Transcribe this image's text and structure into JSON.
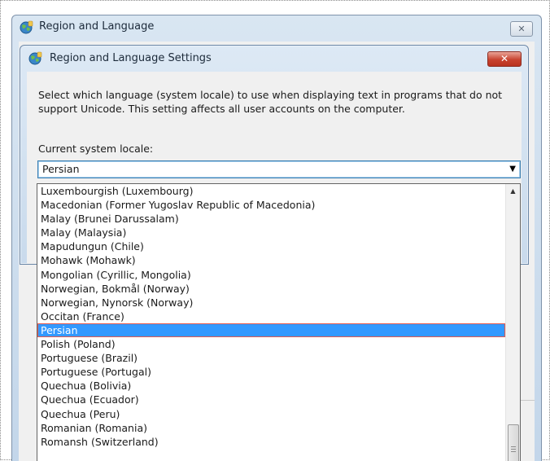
{
  "outer_window": {
    "title": "Region and Language",
    "close_glyph": "✕"
  },
  "dialog": {
    "title": "Region and Language Settings",
    "close_glyph": "✕",
    "description": "Select which language (system locale) to use when displaying text in programs that do not support Unicode. This setting affects all user accounts on the computer.",
    "locale_label": "Current system locale:",
    "locale_value": "Persian",
    "combo_arrow_glyph": "▼"
  },
  "dropdown": {
    "scroll_up_glyph": "▲",
    "items": [
      "Luxembourgish (Luxembourg)",
      "Macedonian (Former Yugoslav Republic of Macedonia)",
      "Malay (Brunei Darussalam)",
      "Malay (Malaysia)",
      "Mapudungun (Chile)",
      "Mohawk (Mohawk)",
      "Mongolian (Cyrillic, Mongolia)",
      "Norwegian, Bokmål (Norway)",
      "Norwegian, Nynorsk (Norway)",
      "Occitan (France)",
      "Persian",
      "Polish (Poland)",
      "Portuguese (Brazil)",
      "Portuguese (Portugal)",
      "Quechua (Bolivia)",
      "Quechua (Ecuador)",
      "Quechua (Peru)",
      "Romanian (Romania)",
      "Romansh (Switzerland)"
    ],
    "selected_index": 10
  },
  "icons": {
    "window_icon": "globe-icon",
    "close": "close-icon",
    "dropdown_arrow": "chevron-down-icon"
  },
  "colors": {
    "selection": "#3399ff",
    "selection_outline": "#e3594e",
    "close_red": "#c8432f"
  }
}
